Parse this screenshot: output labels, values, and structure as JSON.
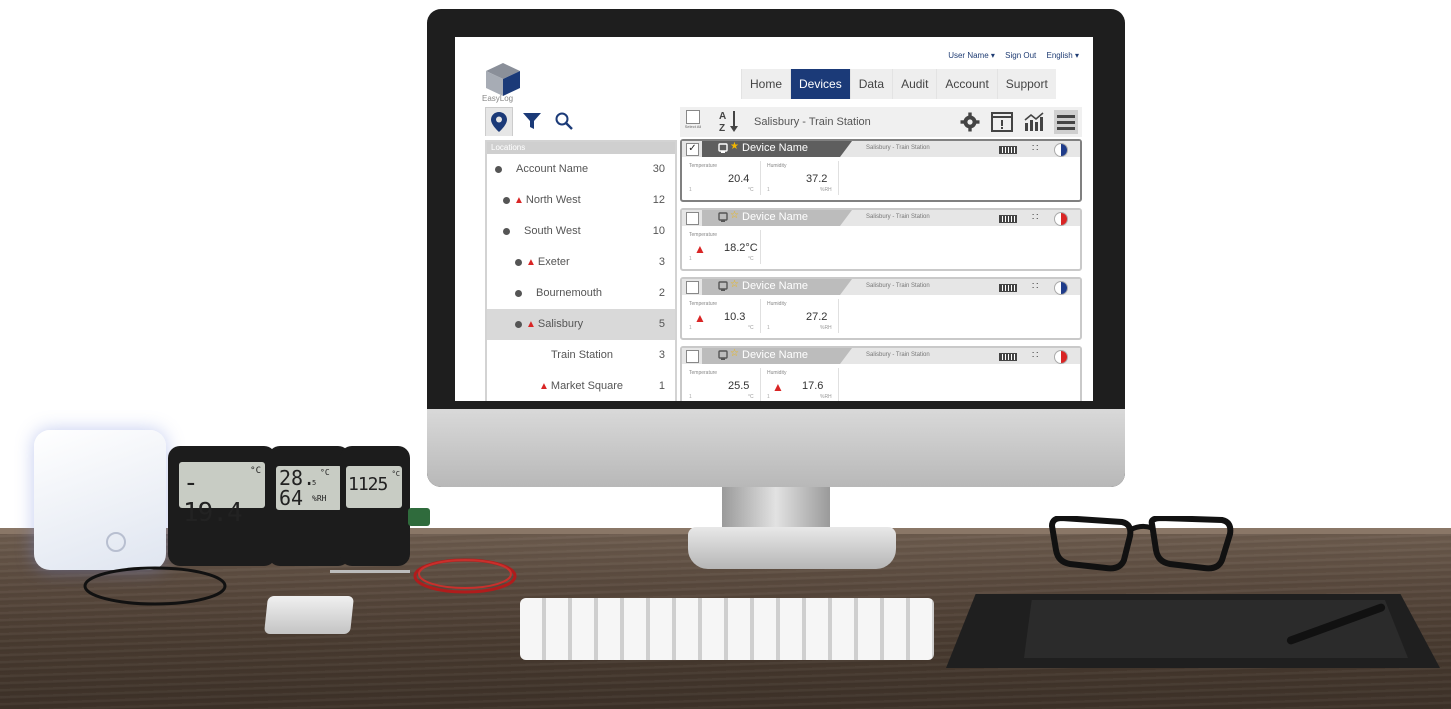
{
  "app": {
    "logo_text": "EasyLog",
    "top_links": [
      "User Name ▾",
      "Sign Out",
      "English ▾"
    ],
    "nav": [
      "Home",
      "Devices",
      "Data",
      "Audit",
      "Account",
      "Support"
    ],
    "active_nav": "Devices"
  },
  "left_panel": {
    "icons": [
      "location-pin-icon",
      "filter-icon",
      "search-icon"
    ],
    "tree_header": "Locations",
    "tree": [
      {
        "label": "Account Name",
        "count": "30",
        "indent": 0,
        "dot": true,
        "alarm": false
      },
      {
        "label": "North West",
        "count": "12",
        "indent": 1,
        "dot": true,
        "alarm": true
      },
      {
        "label": "South West",
        "count": "10",
        "indent": 1,
        "dot": true,
        "alarm": false
      },
      {
        "label": "Exeter",
        "count": "3",
        "indent": 2,
        "dot": true,
        "alarm": true
      },
      {
        "label": "Bournemouth",
        "count": "2",
        "indent": 2,
        "dot": true,
        "alarm": false
      },
      {
        "label": "Salisbury",
        "count": "5",
        "indent": 2,
        "dot": true,
        "alarm": true
      },
      {
        "label": "Train Station",
        "count": "3",
        "indent": 3,
        "dot": false,
        "alarm": false
      },
      {
        "label": "Market Square",
        "count": "1",
        "indent": 3,
        "dot": false,
        "alarm": true
      }
    ]
  },
  "toolbar": {
    "select_all_label": "Select All",
    "sort_label": "A↓Z",
    "breadcrumb": "Salisbury - Train Station",
    "icons": [
      "gear-icon",
      "alarm-panel-icon",
      "chart-icon",
      "list-view-icon"
    ]
  },
  "devices": [
    {
      "name": "Device Name",
      "location": "Salisbury - Train Station",
      "checked": true,
      "status_color": "#1f3c8a",
      "readings": [
        {
          "label": "Temperature",
          "value": "20.4",
          "unit": "°C",
          "index": "1",
          "alarm": false
        },
        {
          "label": "Humidity",
          "value": "37.2",
          "unit": "%RH",
          "index": "1",
          "alarm": false
        }
      ]
    },
    {
      "name": "Device Name",
      "location": "Salisbury - Train Station",
      "checked": false,
      "status_color": "#d92525",
      "readings": [
        {
          "label": "Temperature",
          "value": "18.2°C",
          "unit": "°C",
          "index": "1",
          "alarm": true
        }
      ]
    },
    {
      "name": "Device Name",
      "location": "Salisbury - Train Station",
      "checked": false,
      "status_color": "#1f3c8a",
      "readings": [
        {
          "label": "Temperature",
          "value": "10.3",
          "unit": "°C",
          "index": "1",
          "alarm": true
        },
        {
          "label": "Humidity",
          "value": "27.2",
          "unit": "%RH",
          "index": "1",
          "alarm": false
        }
      ]
    },
    {
      "name": "Device Name",
      "location": "Salisbury - Train Station",
      "checked": false,
      "status_color": "#d92525",
      "readings": [
        {
          "label": "Temperature",
          "value": "25.5",
          "unit": "°C",
          "index": "1",
          "alarm": false
        },
        {
          "label": "Humidity",
          "value": "17.6",
          "unit": "%RH",
          "index": "1",
          "alarm": true
        }
      ]
    }
  ],
  "hardware_displays": {
    "logger1": "- 19.4",
    "logger1_unit": "°C",
    "logger2_top": "28.",
    "logger2_top_decimal": "5",
    "logger2_top_unit": "°C",
    "logger2_bottom": "64",
    "logger2_bottom_unit": "%RH",
    "logger3": "1125",
    "logger3_unit": "°C"
  },
  "colors": {
    "brand_navy": "#1b3a78",
    "alarm_red": "#d92525",
    "star_yellow": "#f2b600"
  }
}
